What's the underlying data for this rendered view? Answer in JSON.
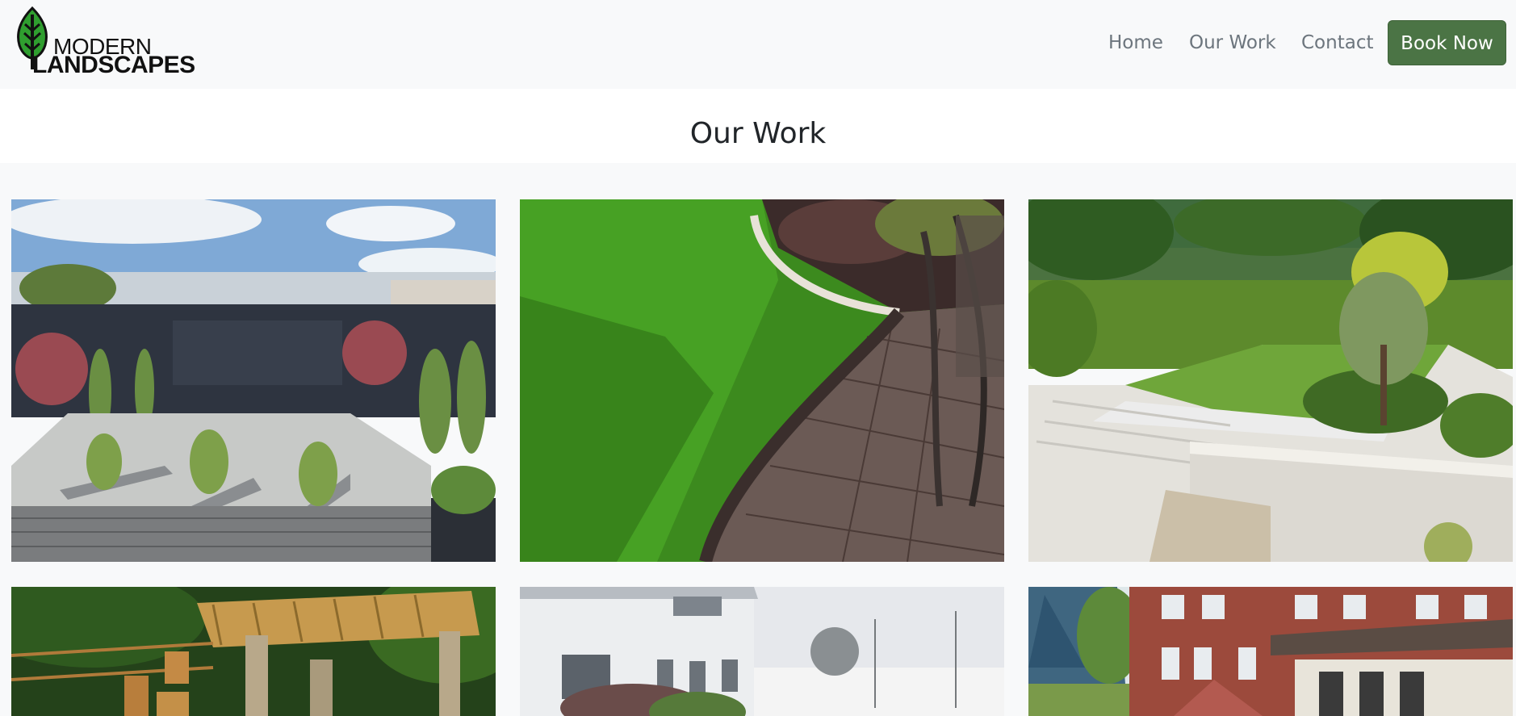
{
  "brand": {
    "line1": "MODERN",
    "line2": "LANDSCAPES",
    "logo_icon": "leaf-icon",
    "leaf_color": "#2f9e2f"
  },
  "nav": {
    "items": [
      {
        "label": "Home"
      },
      {
        "label": "Our Work"
      },
      {
        "label": "Contact"
      }
    ],
    "cta_label": "Book Now",
    "cta_color": "#4b7445"
  },
  "page": {
    "title": "Our Work"
  },
  "gallery": {
    "images": [
      {
        "name": "garden-patio-image"
      },
      {
        "name": "artificial-lawn-paving-image"
      },
      {
        "name": "terraced-garden-image"
      },
      {
        "name": "pergola-deck-image"
      },
      {
        "name": "white-house-garden-image"
      },
      {
        "name": "brick-house-yard-image"
      }
    ]
  }
}
